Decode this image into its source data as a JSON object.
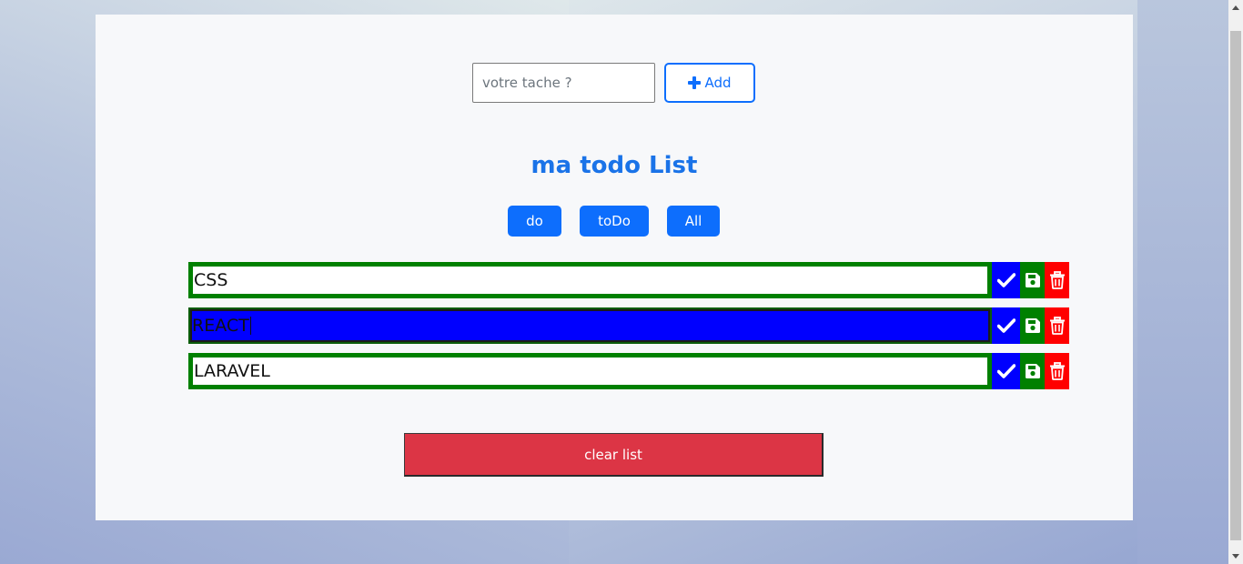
{
  "add_form": {
    "placeholder": "votre tache ?",
    "add_label": "Add"
  },
  "title": "ma todo List",
  "filters": {
    "do_label": "do",
    "todo_label": "toDo",
    "all_label": "All"
  },
  "tasks": [
    {
      "text": "CSS",
      "selected": false
    },
    {
      "text": "REACT",
      "selected": true
    },
    {
      "text": "LARAVEL",
      "selected": false
    }
  ],
  "clear_label": "clear list",
  "colors": {
    "primary": "#0d6efd",
    "done_border": "#008000",
    "check_bg": "#0000ff",
    "save_bg": "#008000",
    "delete_bg": "#ff0000",
    "clear_bg": "#dc3545",
    "title": "#1a73e8"
  },
  "icons": {
    "add": "plus-icon",
    "check": "check-icon",
    "save": "floppy-disk-icon",
    "delete": "trash-icon"
  }
}
